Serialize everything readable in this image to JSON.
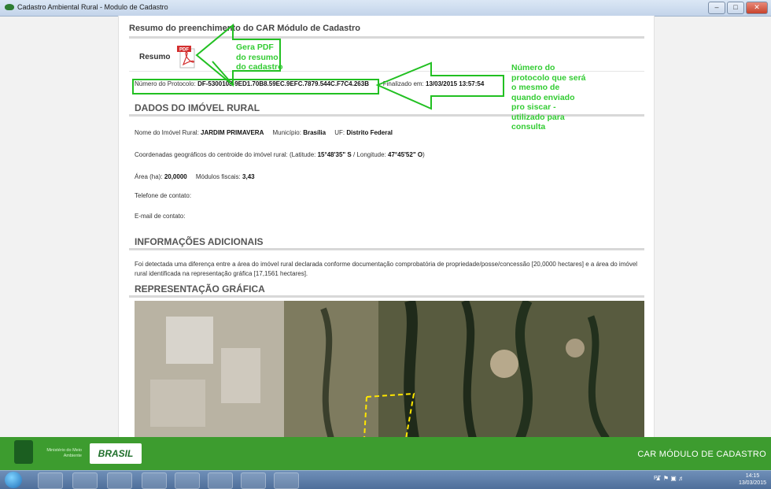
{
  "window": {
    "title": "Cadastro Ambiental Rural - Modulo de Cadastro"
  },
  "page": {
    "heading": "Resumo do preenchimento do CAR Módulo de Cadastro",
    "tab_label": "Resumo",
    "pdf_label": "PDF",
    "protocol": {
      "label": "Número do Protocolo:",
      "value": "DF-5300108-9ED1.70B8.59EC.9EFC.7879.544C.F7C4.263B",
      "finalizado_label": "Finalizado em:",
      "finalizado_value": "13/03/2015 13:57:54"
    },
    "dados": {
      "title": "DADOS DO IMÓVEL RURAL",
      "nome_label": "Nome do Imóvel Rural:",
      "nome_value": "JARDIM PRIMAVERA",
      "municipio_label": "Município:",
      "municipio_value": "Brasília",
      "uf_label": "UF:",
      "uf_value": "Distrito Federal",
      "coord_label": "Coordenadas geográficos do centroide do imóvel rural: (Latitude:",
      "lat_value": "15°48'35\" S",
      "lon_label": "/ Longitude:",
      "lon_value": "47°45'52\" O",
      "coord_end": ")",
      "area_label": "Área (ha):",
      "area_value": "20,0000",
      "modulos_label": "Módulos fiscais:",
      "modulos_value": "3,43",
      "telefone_label": "Telefone de contato:",
      "email_label": "E-mail de contato:"
    },
    "info": {
      "title": "INFORMAÇÕES ADICIONAIS",
      "text": "Foi detectada uma diferença entre a área do imóvel rural declarada conforme documentação comprobatória de propriedade/posse/concessão [20,0000 hectares] e a área do imóvel rural identificada na representação gráfica [17,1561 hectares]."
    },
    "grafica": {
      "title": "REPRESENTAÇÃO GRÁFICA"
    }
  },
  "annotations": {
    "pdf_note": "Gera PDF do resumo do cadastro",
    "protocol_note": "Número do protocolo que será o mesmo de quando enviado pro siscar - utilizado para consulta"
  },
  "footer": {
    "ministerio": "Ministério do Meio Ambiente",
    "brasil": "BRASIL",
    "right_text": "CAR MÓDULO DE CADASTRO"
  },
  "taskbar": {
    "lang": "PT",
    "time": "14:15",
    "date": "13/03/2015"
  },
  "colors": {
    "annotation": "#33cc33",
    "footer": "#3d9c2f",
    "header_gray": "#555555"
  }
}
